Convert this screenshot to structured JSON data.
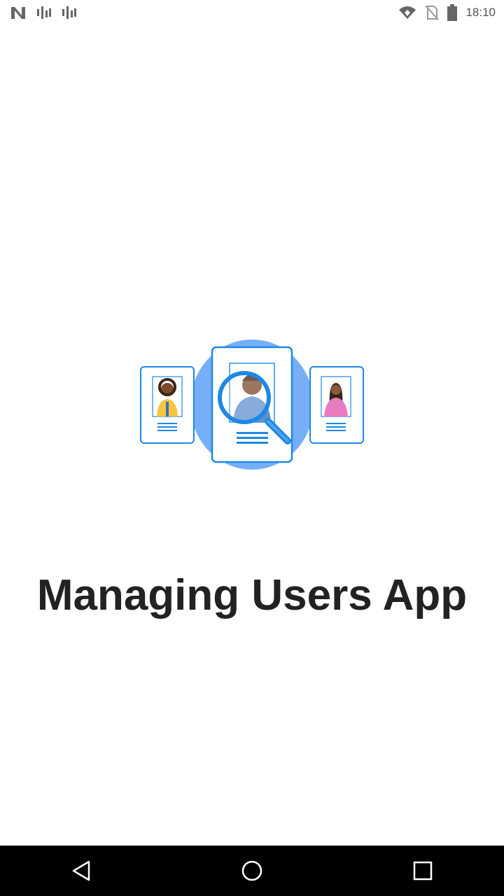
{
  "status_bar": {
    "time": "18:10",
    "left_icons": [
      "n-logo-icon",
      "signal-bars-icon",
      "signal-bars-icon"
    ],
    "right_icons": [
      "wifi-icon",
      "no-sim-icon",
      "battery-icon"
    ]
  },
  "splash": {
    "illustration": "user-profiles-search-illustration",
    "title": "Managing Users App"
  },
  "nav_bar": {
    "buttons": [
      "back-icon",
      "home-icon",
      "recents-icon"
    ]
  },
  "colors": {
    "accent": "#1e88e5",
    "circle": "#76aff8",
    "title_text": "#222222",
    "nav_background": "#000000"
  }
}
